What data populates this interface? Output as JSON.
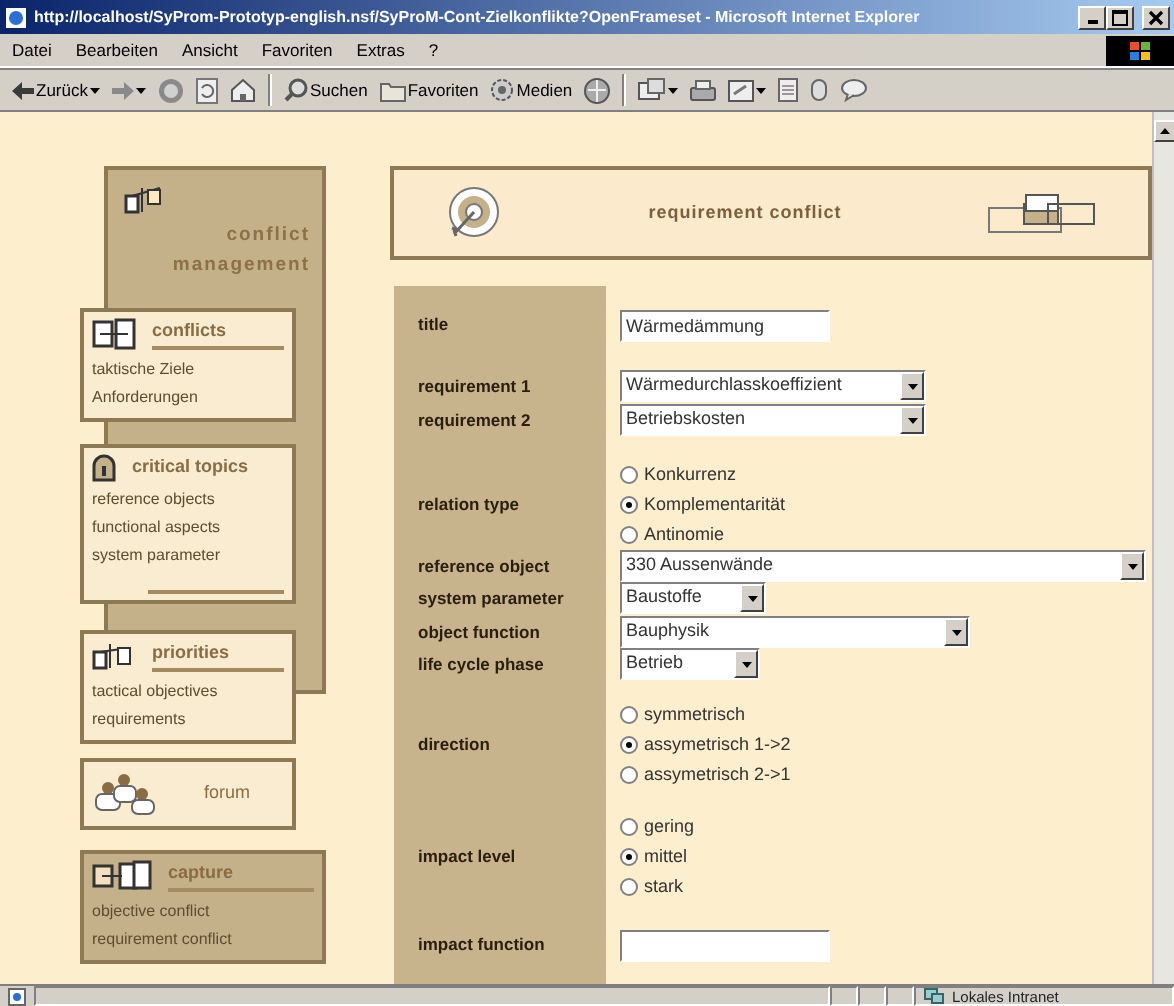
{
  "window": {
    "title": "http://localhost/SyProm-Prototyp-english.nsf/SyProM-Cont-Zielkonflikte?OpenFrameset - Microsoft Internet Explorer"
  },
  "menu": [
    "Datei",
    "Bearbeiten",
    "Ansicht",
    "Favoriten",
    "Extras",
    "?"
  ],
  "toolbar": [
    "Zurück",
    "Suchen",
    "Favoriten",
    "Medien"
  ],
  "nav": {
    "title": "conflict management",
    "sections": [
      {
        "title": "conflicts",
        "kind": "light",
        "links": [
          "taktische Ziele",
          "Anforderungen"
        ]
      },
      {
        "title": "critical topics",
        "kind": "light",
        "links": [
          "reference objects",
          "functional aspects",
          "system parameter"
        ]
      },
      {
        "title": "priorities",
        "kind": "light",
        "links": [
          "tactical objectives",
          "requirements"
        ]
      },
      {
        "title": "forum",
        "kind": "light"
      },
      {
        "title": "capture",
        "kind": "dark",
        "links": [
          "objective conflict",
          "requirement conflict"
        ]
      }
    ]
  },
  "header": {
    "title": "requirement conflict"
  },
  "form": [
    {
      "label": "title",
      "kind": "text",
      "value": "Wärmedämmung"
    },
    {
      "label": "requirement 1",
      "kind": "select",
      "value": "Wärmedurchlasskoeffizient"
    },
    {
      "label": "requirement 2",
      "kind": "select",
      "value": "Betriebskosten"
    },
    {
      "label": "relation type",
      "kind": "radio",
      "options": [
        {
          "label": "Konkurrenz",
          "selected": false
        },
        {
          "label": "Komplementarität",
          "selected": true
        },
        {
          "label": "Antinomie",
          "selected": false
        }
      ]
    },
    {
      "label": "reference object",
      "kind": "select",
      "value": "330 Aussenwände"
    },
    {
      "label": "system parameter",
      "kind": "select",
      "value": "Baustoffe"
    },
    {
      "label": "object function",
      "kind": "select",
      "value": "Bauphysik"
    },
    {
      "label": "life cycle phase",
      "kind": "select",
      "value": "Betrieb"
    },
    {
      "label": "direction",
      "kind": "radio",
      "options": [
        {
          "label": "symmetrisch",
          "selected": false
        },
        {
          "label": "assymetrisch 1->2",
          "selected": true
        },
        {
          "label": "assymetrisch 2->1",
          "selected": false
        }
      ]
    },
    {
      "label": "impact level",
      "kind": "radio",
      "options": [
        {
          "label": "gering",
          "selected": false
        },
        {
          "label": "mittel",
          "selected": true
        },
        {
          "label": "stark",
          "selected": false
        }
      ]
    },
    {
      "label": "impact function",
      "kind": "text"
    }
  ],
  "status_bar": {
    "zone": "Lokales Intranet"
  }
}
